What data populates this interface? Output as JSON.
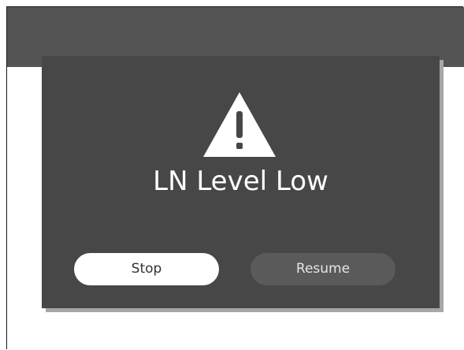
{
  "alert": {
    "title": "LN Level Low",
    "icon": "warning-triangle",
    "buttons": {
      "stop": "Stop",
      "resume": "Resume"
    }
  },
  "colors": {
    "top_bar": "#545454",
    "dialog_bg": "#474747",
    "dialog_shadow": "#a6a6a6",
    "stop_button_bg": "#ffffff",
    "resume_button_bg": "#5a5a5a",
    "text_light": "#ffffff"
  }
}
